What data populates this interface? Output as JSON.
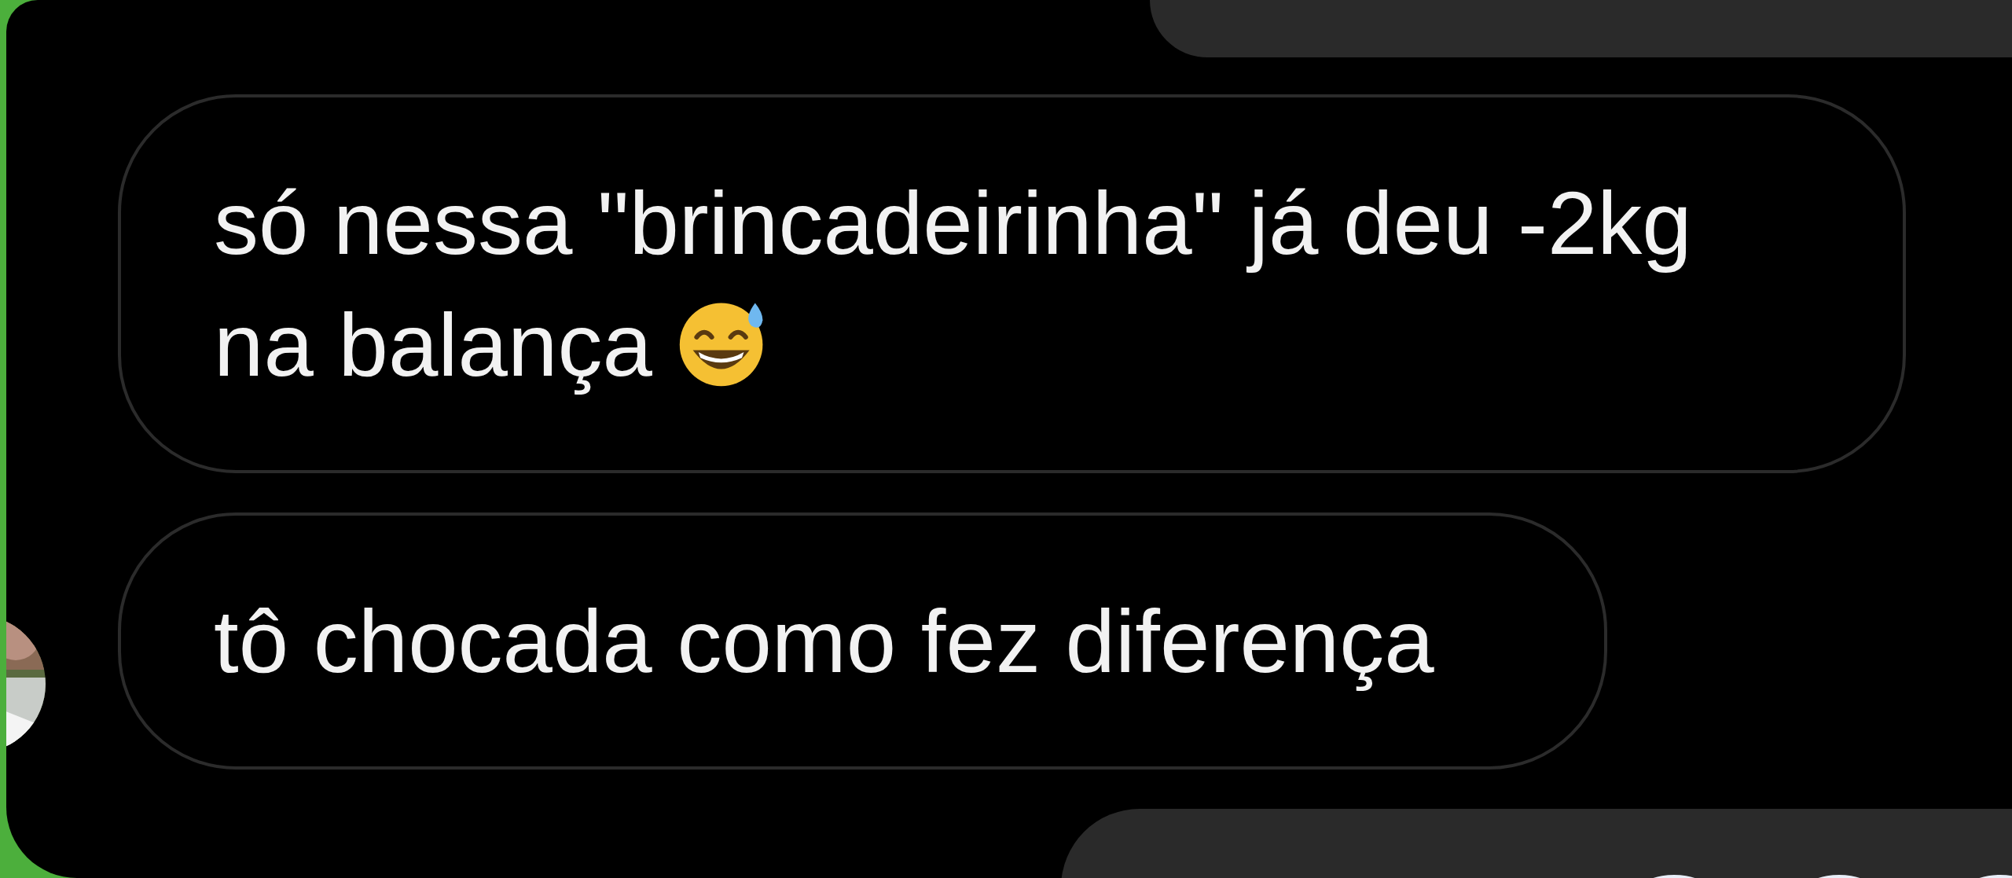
{
  "messages": [
    {
      "text": "só nessa \"brincadeirinha\" já deu -2kg na balança",
      "emoji": true
    },
    {
      "text": "tô chocada como fez diferença",
      "emoji": false
    }
  ]
}
